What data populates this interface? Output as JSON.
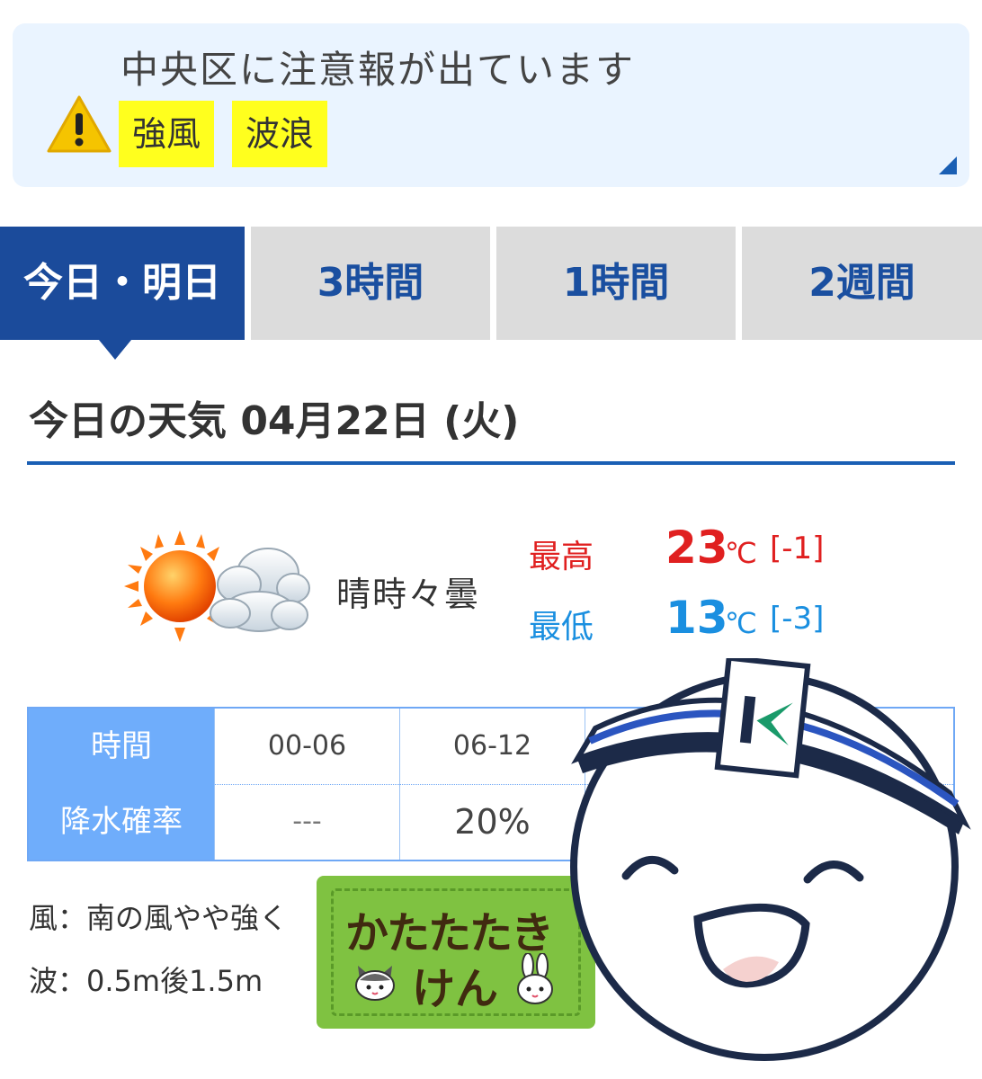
{
  "alert": {
    "title": "中央区に注意報が出ています",
    "badges": [
      "強風",
      "波浪"
    ]
  },
  "tabs": [
    "今日・明日",
    "3時間",
    "1時間",
    "2週間"
  ],
  "section_title": "今日の天気 04月22日 (火)",
  "forecast": {
    "condition": "晴時々曇",
    "icon": "sun-cloud-icon",
    "high_label": "最高",
    "high_value": "23",
    "high_unit": "℃",
    "high_diff": "[-1]",
    "low_label": "最低",
    "low_value": "13",
    "low_unit": "℃",
    "low_diff": "[-3]"
  },
  "precip_table": {
    "time_header": "時間",
    "rain_header": "降水確率",
    "times": [
      "00-06",
      "06-12"
    ],
    "rain": [
      "---",
      "20%"
    ]
  },
  "wind_text": "風：南の風やや強く",
  "wave_text": "波：0.5m後1.5m",
  "sticker": {
    "line1": "かたたたき",
    "line2": "けん"
  },
  "colors": {
    "accent": "#1b4b9b",
    "high": "#e02020",
    "low": "#1a8fe0",
    "badge": "#ffff1e"
  }
}
